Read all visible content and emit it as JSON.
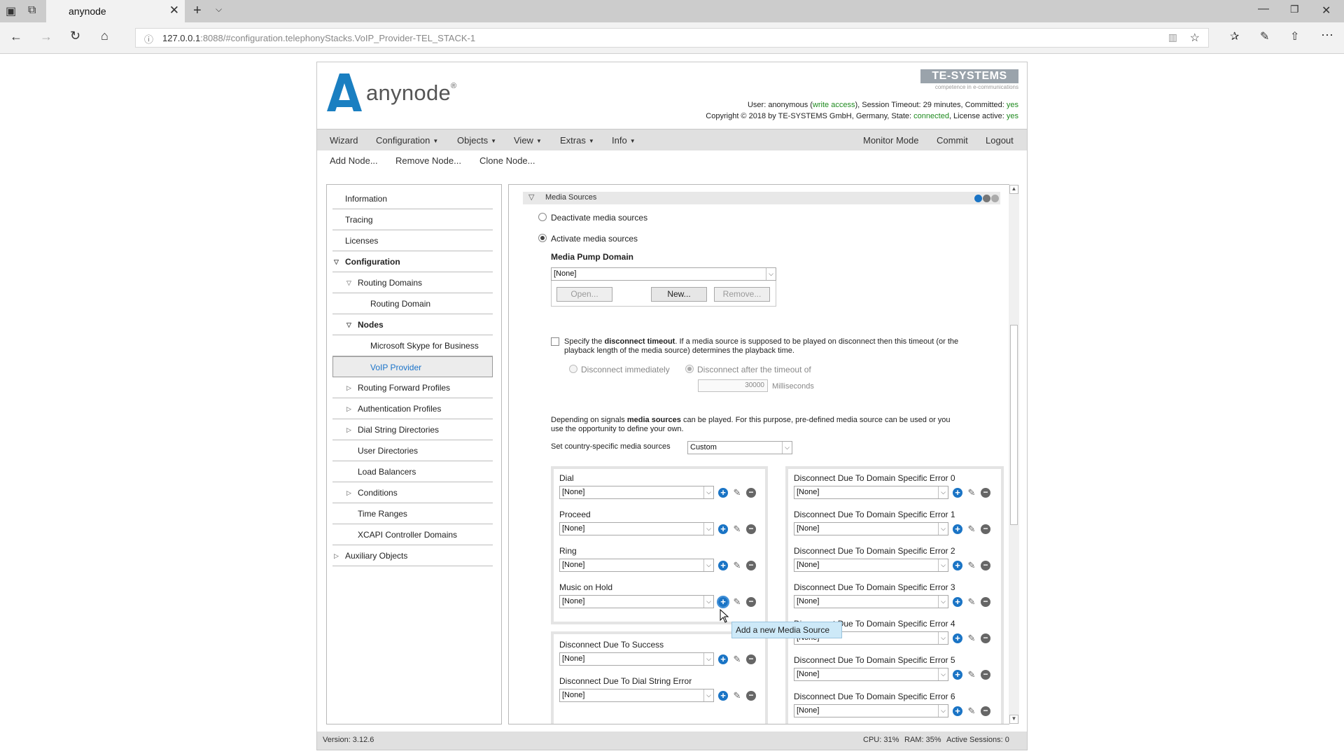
{
  "browser": {
    "tab_title": "anynode",
    "url_host": "127.0.0.1",
    "url_rest": ":8088/#configuration.telephonyStacks.VoIP_Provider-TEL_STACK-1"
  },
  "header": {
    "logo_text": "anynode",
    "logo_reg": "®",
    "vendor": "TE-SYSTEMS",
    "vendor_sub": "competence in e-communications",
    "user_prefix": "User: anonymous (",
    "user_access": "write access",
    "user_mid": "), Session Timeout: 29 minutes, Committed: ",
    "committed": "yes",
    "copyright_prefix": "Copyright © 2018 by TE-SYSTEMS GmbH, Germany, State: ",
    "state": "connected",
    "license_prefix": ", License active: ",
    "license": "yes"
  },
  "menu": {
    "wizard": "Wizard",
    "configuration": "Configuration",
    "objects": "Objects",
    "view": "View",
    "extras": "Extras",
    "info": "Info",
    "monitor": "Monitor Mode",
    "commit": "Commit",
    "logout": "Logout"
  },
  "submenu": {
    "add": "Add Node...",
    "remove": "Remove Node...",
    "clone": "Clone Node..."
  },
  "sidebar": {
    "items": [
      "Information",
      "Tracing",
      "Licenses",
      "Configuration",
      "Routing Domains",
      "Routing Domain",
      "Nodes",
      "Microsoft Skype for Business",
      "VoIP Provider",
      "Routing Forward Profiles",
      "Authentication Profiles",
      "Dial String Directories",
      "User Directories",
      "Load Balancers",
      "Conditions",
      "Time Ranges",
      "XCAPI Controller Domains",
      "Auxiliary Objects"
    ]
  },
  "media": {
    "section_title": "Media Sources",
    "deactivate": "Deactivate media sources",
    "activate": "Activate media sources",
    "pump_label": "Media Pump Domain",
    "pump_value": "[None]",
    "open": "Open...",
    "new": "New...",
    "remove": "Remove...",
    "disc_a": "Specify the ",
    "disc_b": "disconnect timeout",
    "disc_c": ". If a media source is supposed to be played on disconnect then this timeout (or the",
    "disc_d": "playback length of the media source) determines the playback time.",
    "disc_immediate": "Disconnect immediately",
    "disc_after": "Disconnect after the timeout of",
    "timeout_value": "30000",
    "timeout_unit": "Milliseconds",
    "dep_a": "Depending on signals ",
    "dep_b": "media sources",
    "dep_c": " can be played. For this purpose, pre-defined media source can be used or you",
    "dep_d": "use the opportunity to define your own.",
    "country_label": "Set country-specific media sources",
    "country_value": "Custom",
    "left_group1": [
      {
        "label": "Dial",
        "value": "[None]"
      },
      {
        "label": "Proceed",
        "value": "[None]"
      },
      {
        "label": "Ring",
        "value": "[None]"
      },
      {
        "label": "Music on Hold",
        "value": "[None]"
      }
    ],
    "left_group2": [
      {
        "label": "Disconnect Due To Success",
        "value": "[None]"
      },
      {
        "label": "Disconnect Due To Dial String Error",
        "value": "[None]"
      }
    ],
    "right_group": [
      {
        "label": "Disconnect Due To Domain Specific Error 0",
        "value": "[None]"
      },
      {
        "label": "Disconnect Due To Domain Specific Error 1",
        "value": "[None]"
      },
      {
        "label": "Disconnect Due To Domain Specific Error 2",
        "value": "[None]"
      },
      {
        "label": "Disconnect Due To Domain Specific Error 3",
        "value": "[None]"
      },
      {
        "label": "Disconnect Due To Domain Specific Error 4",
        "value": "[None]"
      },
      {
        "label": "Disconnect Due To Domain Specific Error 5",
        "value": "[None]"
      },
      {
        "label": "Disconnect Due To Domain Specific Error 6",
        "value": "[None]"
      }
    ],
    "tooltip": "Add a new Media Source"
  },
  "status": {
    "version": "Version: 3.12.6",
    "cpu": "CPU: 31%",
    "ram": "RAM: 35%",
    "sessions": "Active Sessions: 0"
  },
  "colors": {
    "accent": "#1a74c5",
    "green": "#1e8a1e",
    "logo": "#1a7fc1"
  }
}
